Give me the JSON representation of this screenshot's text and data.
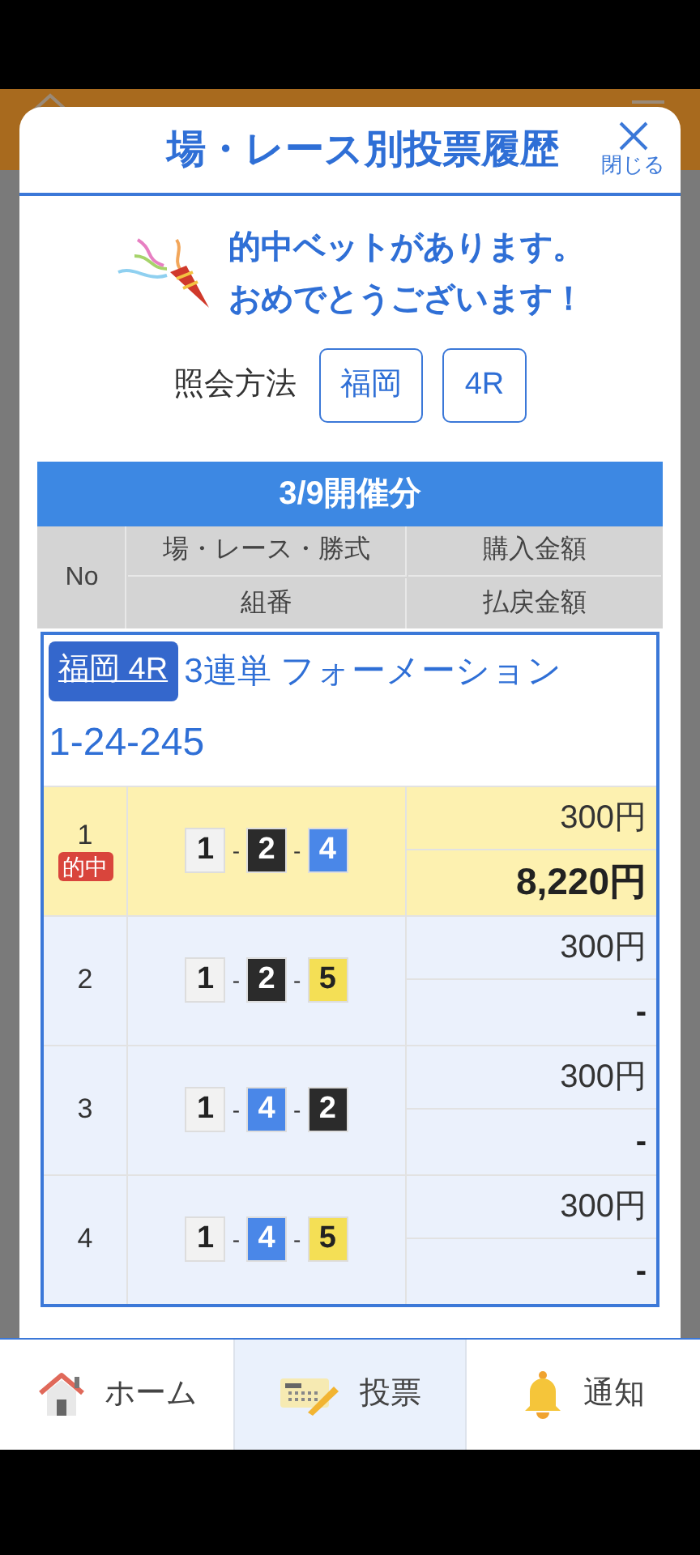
{
  "dialog": {
    "title": "場・レース別投票履歴",
    "close_label": "閉じる",
    "message": [
      "的中ベットがあります。",
      "おめでとうございます！"
    ],
    "query": {
      "label": "照会方法",
      "chips": [
        "福岡",
        "4R"
      ]
    },
    "table": {
      "date_header": "3/9開催分",
      "columns": {
        "no": "No",
        "race_type": "場・レース・勝式",
        "combination": "組番",
        "bet_amount": "購入金額",
        "payout": "払戻金額"
      },
      "entry": {
        "place_link": "福岡 4R",
        "bet_type": "3連単 フォーメーション",
        "formation": "1-24-245",
        "rows": [
          {
            "no": "1",
            "hit": true,
            "hit_badge": "的中",
            "boats": [
              {
                "kind": "boat",
                "number": "1",
                "color": "#f2f2f2"
              },
              {
                "kind": "dash",
                "text": "-"
              },
              {
                "kind": "boat",
                "number": "2",
                "color": "#2b2b2b"
              },
              {
                "kind": "dash",
                "text": "-"
              },
              {
                "kind": "boat",
                "number": "4",
                "color": "#4a87e8"
              }
            ],
            "bet": "300円",
            "payout": "8,220円"
          },
          {
            "no": "2",
            "hit": false,
            "boats": [
              {
                "kind": "boat",
                "number": "1",
                "color": "#f2f2f2"
              },
              {
                "kind": "dash",
                "text": "-"
              },
              {
                "kind": "boat",
                "number": "2",
                "color": "#2b2b2b"
              },
              {
                "kind": "dash",
                "text": "-"
              },
              {
                "kind": "boat",
                "number": "5",
                "color": "#f4df55"
              }
            ],
            "bet": "300円",
            "payout": "-"
          },
          {
            "no": "3",
            "hit": false,
            "boats": [
              {
                "kind": "boat",
                "number": "1",
                "color": "#f2f2f2"
              },
              {
                "kind": "dash",
                "text": "-"
              },
              {
                "kind": "boat",
                "number": "4",
                "color": "#4a87e8"
              },
              {
                "kind": "dash",
                "text": "-"
              },
              {
                "kind": "boat",
                "number": "2",
                "color": "#2b2b2b"
              }
            ],
            "bet": "300円",
            "payout": "-"
          },
          {
            "no": "4",
            "hit": false,
            "boats": [
              {
                "kind": "boat",
                "number": "1",
                "color": "#f2f2f2"
              },
              {
                "kind": "dash",
                "text": "-"
              },
              {
                "kind": "boat",
                "number": "4",
                "color": "#4a87e8"
              },
              {
                "kind": "dash",
                "text": "-"
              },
              {
                "kind": "boat",
                "number": "5",
                "color": "#f4df55"
              }
            ],
            "bet": "300円",
            "payout": "-"
          }
        ]
      }
    }
  },
  "bottom_nav": [
    {
      "kind": "home",
      "label": "ホーム",
      "selected": false
    },
    {
      "kind": "ticket",
      "label": "投票",
      "selected": true
    },
    {
      "kind": "bell",
      "label": "通知",
      "selected": false
    }
  ]
}
